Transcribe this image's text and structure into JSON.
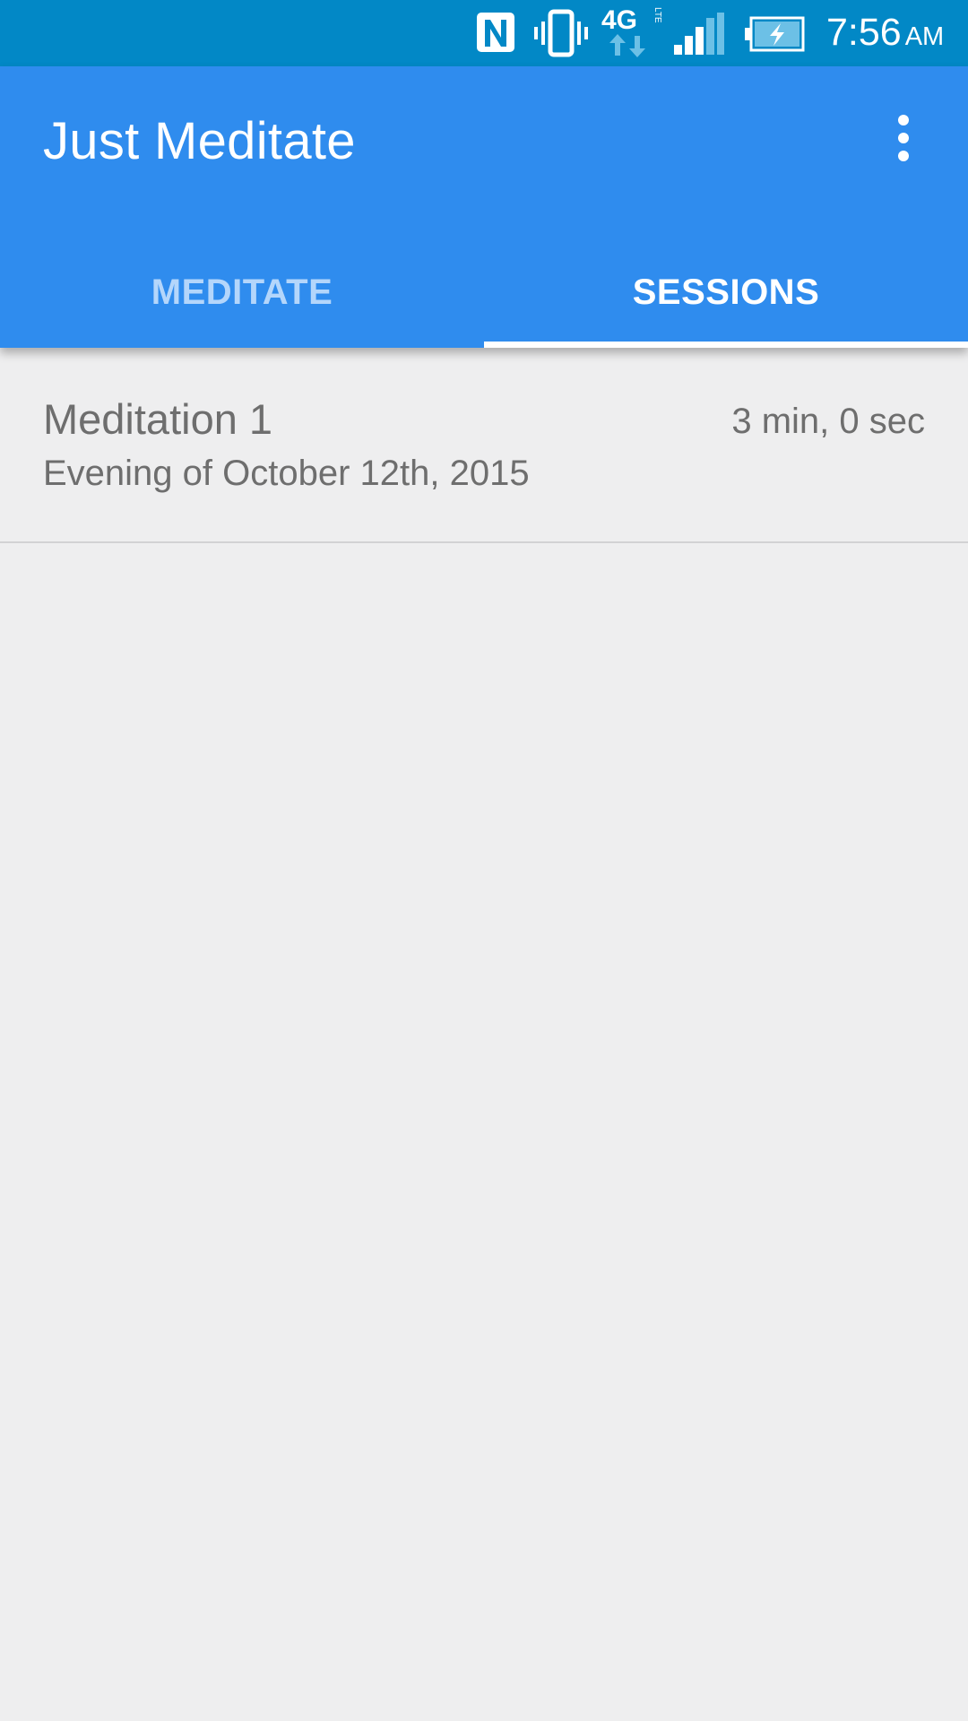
{
  "status_bar": {
    "time": "7:56",
    "ampm": "AM",
    "icons": [
      "nfc-icon",
      "vibrate-icon",
      "lte-data-icon",
      "signal-icon",
      "battery-charging-icon"
    ],
    "network_label": "4G",
    "network_sublabel": "LTE",
    "colors": {
      "background": "#0288c6"
    }
  },
  "app_bar": {
    "title": "Just Meditate",
    "menu_icon": "more-vert-icon",
    "colors": {
      "background": "#2f8cee"
    }
  },
  "tabs": [
    {
      "label": "MEDITATE",
      "selected": false
    },
    {
      "label": "SESSIONS",
      "selected": true
    }
  ],
  "sessions": [
    {
      "title": "Meditation 1",
      "date": "Evening of October 12th, 2015",
      "duration": "3 min, 0 sec"
    }
  ]
}
